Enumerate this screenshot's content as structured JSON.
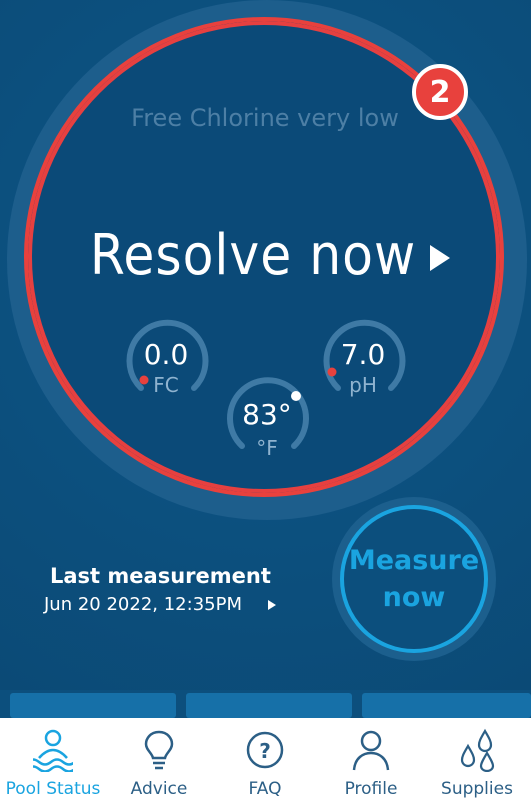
{
  "status": {
    "alert_text": "Free Chlorine very low",
    "action_label": "Resolve now",
    "badge_count": "2"
  },
  "gauges": {
    "fc": {
      "value": "0.0",
      "unit": "FC"
    },
    "temp": {
      "value": "83°",
      "unit": "°F"
    },
    "ph": {
      "value": "7.0",
      "unit": "pH"
    }
  },
  "last_measurement": {
    "title": "Last measurement",
    "datetime": "Jun 20 2022, 12:35PM"
  },
  "measure_button": {
    "line1": "Measure",
    "line2": "now"
  },
  "nav": {
    "items": [
      {
        "label": "Pool Status",
        "icon": "pool-status-icon",
        "active": true
      },
      {
        "label": "Advice",
        "icon": "lightbulb-icon",
        "active": false
      },
      {
        "label": "FAQ",
        "icon": "question-icon",
        "active": false
      },
      {
        "label": "Profile",
        "icon": "person-icon",
        "active": false
      },
      {
        "label": "Supplies",
        "icon": "droplets-icon",
        "active": false
      }
    ]
  },
  "colors": {
    "background": "#0c4f7d",
    "alert_red": "#e8413d",
    "accent_blue": "#1aa4e0",
    "nav_text": "#2c5f86"
  }
}
